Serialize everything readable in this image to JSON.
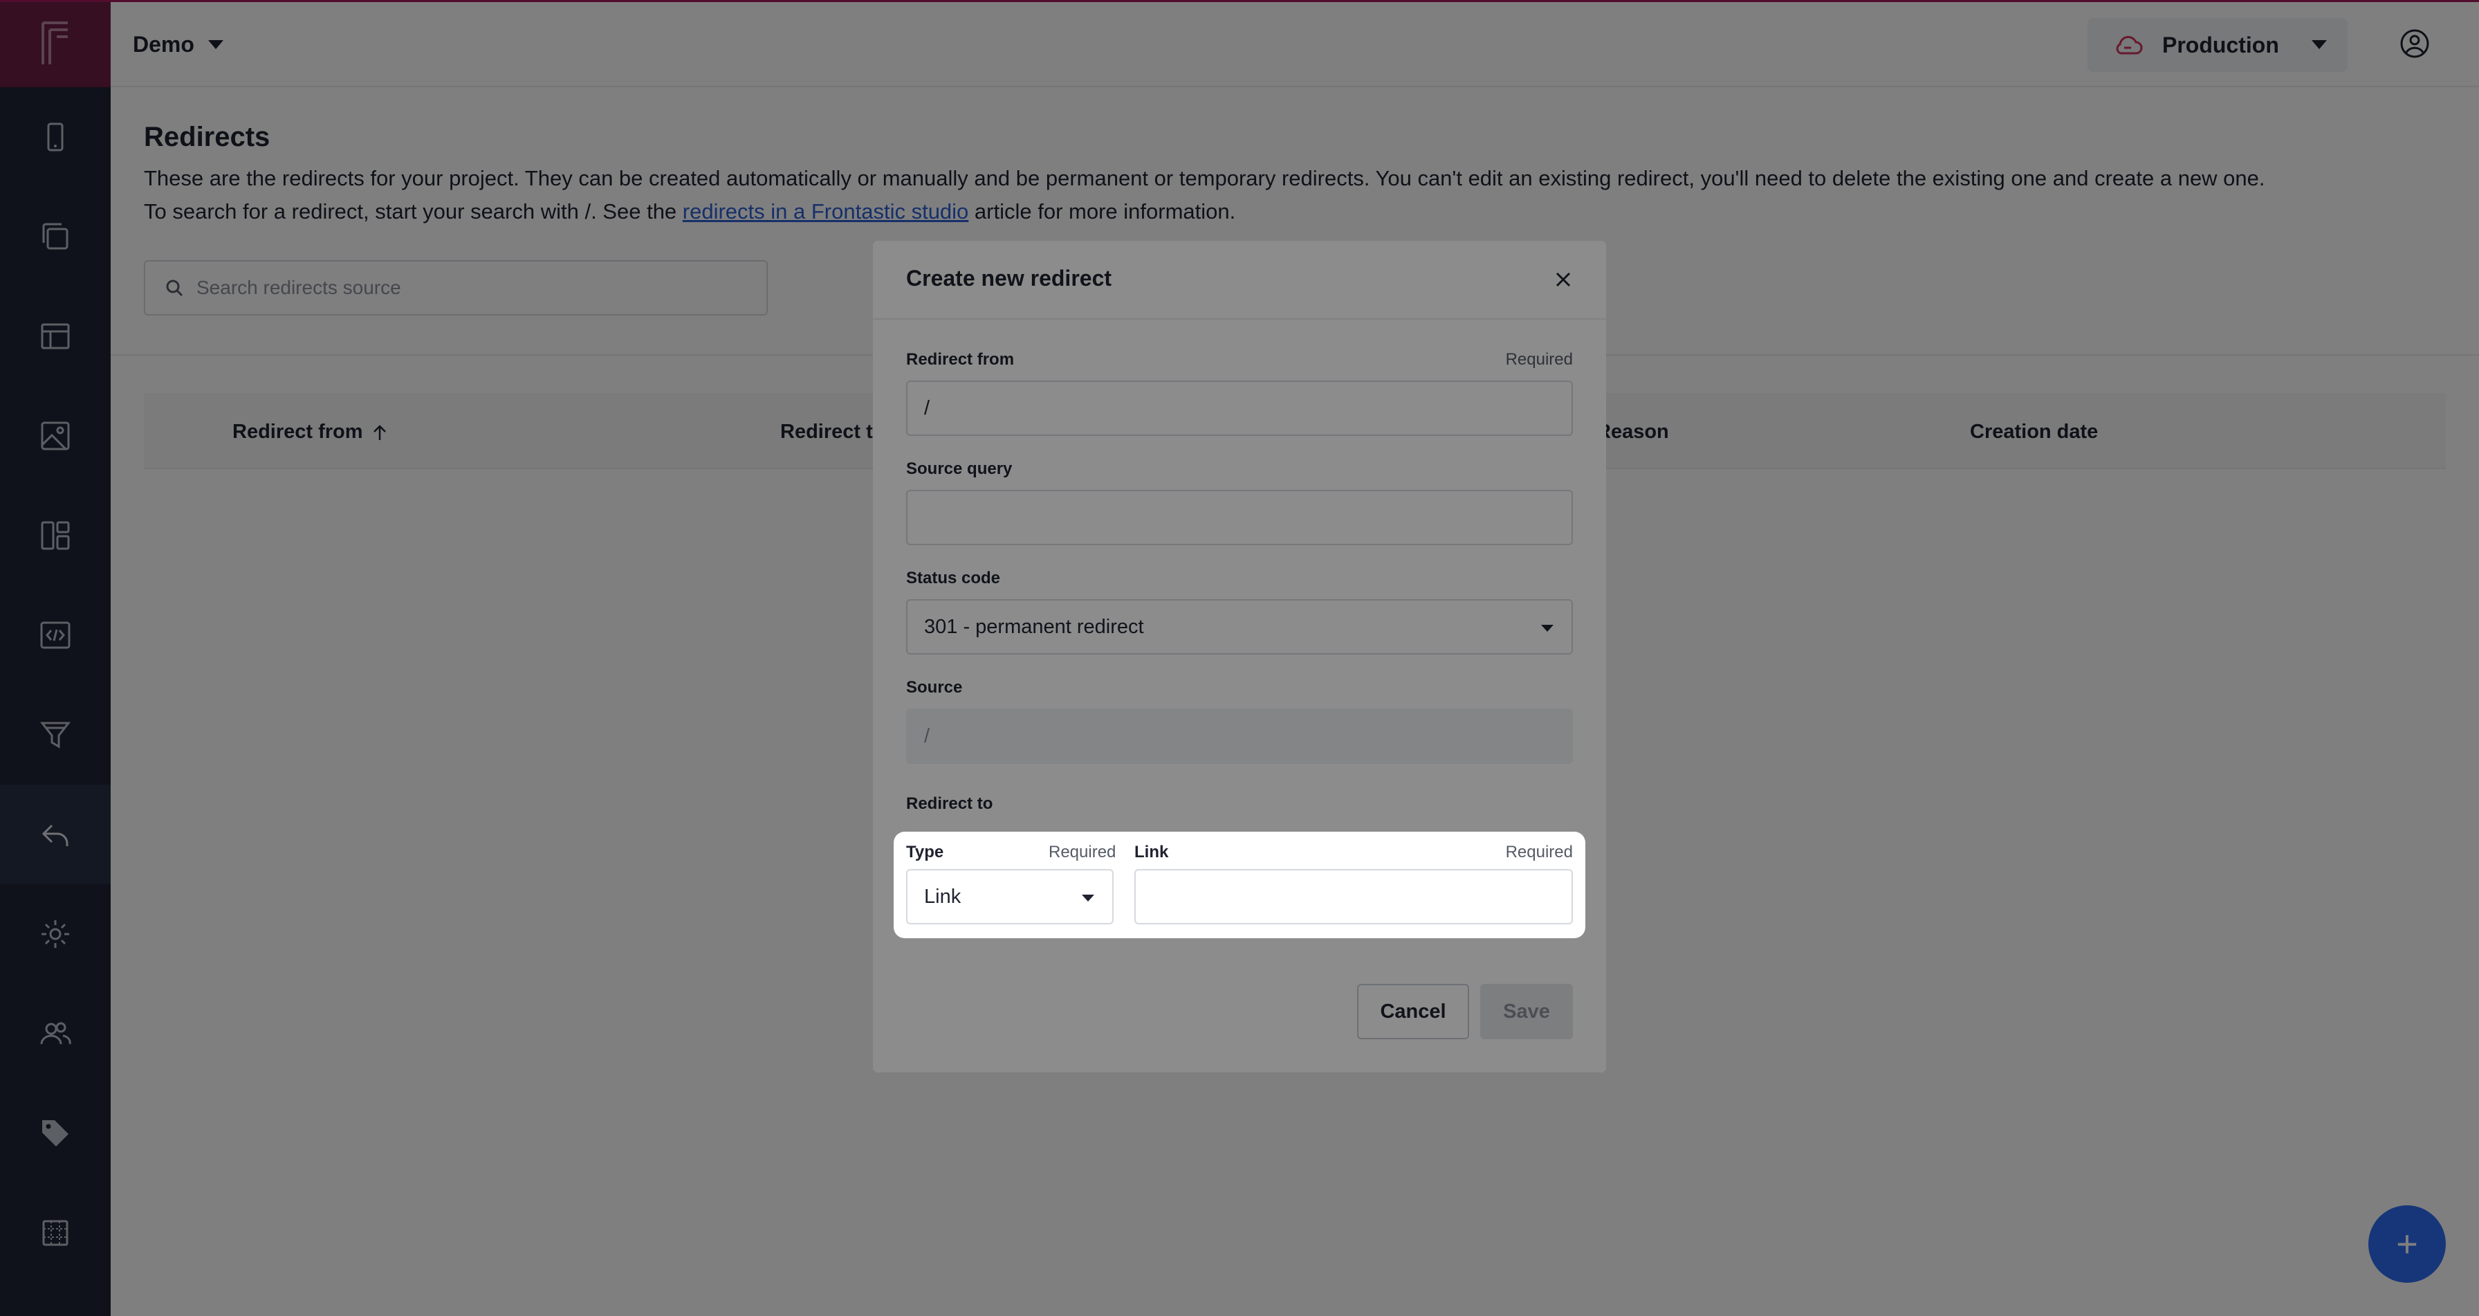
{
  "app": {
    "project_name": "Demo",
    "environment": "Production"
  },
  "sidebar": {
    "items": [
      {
        "name": "mobile-icon"
      },
      {
        "name": "copy-pages-icon"
      },
      {
        "name": "layout-icon"
      },
      {
        "name": "image-icon"
      },
      {
        "name": "dashboard-icon"
      },
      {
        "name": "code-icon"
      },
      {
        "name": "filter-icon"
      },
      {
        "name": "redirect-icon",
        "active": true
      },
      {
        "name": "gear-icon"
      },
      {
        "name": "users-icon"
      },
      {
        "name": "tag-icon"
      },
      {
        "name": "grid-icon"
      }
    ]
  },
  "page": {
    "title": "Redirects",
    "desc_line1": "These are the redirects for your project. They can be created automatically or manually and be permanent or temporary redirects. You can't edit an existing redirect, you'll need to delete the existing one and create a new one.",
    "desc_line2_pre": "To search for a redirect, start your search with /. See the ",
    "desc_link": "redirects in a Frontastic studio",
    "desc_line2_post": " article for more information.",
    "search_placeholder": "Search redirects source",
    "columns": [
      "Redirect from",
      "Redirect to",
      "Reason",
      "Creation date"
    ],
    "col_partial_reason": "ason",
    "fab_label": "+"
  },
  "modal": {
    "title": "Create new redirect",
    "required_text": "Required",
    "redirect_from_label": "Redirect from",
    "redirect_from_value": "/",
    "source_query_label": "Source query",
    "source_query_value": "",
    "status_code_label": "Status code",
    "status_code_value": "301 - permanent redirect",
    "source_label": "Source",
    "source_value": "/",
    "redirect_to_label": "Redirect to",
    "type_label": "Type",
    "type_value": "Link",
    "link_label": "Link",
    "link_value": "",
    "cancel_label": "Cancel",
    "save_label": "Save"
  },
  "colors": {
    "sidebar_bg": "#1e2535",
    "logo_bg": "#6c1f46",
    "accent": "#2e6cf5",
    "link": "#2c5fd4"
  }
}
